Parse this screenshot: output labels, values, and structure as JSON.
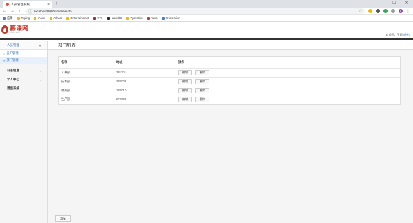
{
  "browser": {
    "tab_title": "人员管理系统",
    "tab_close": "×",
    "new_tab": "+",
    "window_controls": [
      "–",
      "❐",
      "✕"
    ],
    "url": "localhost:8080/sm/main.do",
    "nav_icons": [
      "←",
      "→",
      "↻",
      "ⓘ"
    ],
    "profile_initial": "L",
    "bookmarks": [
      {
        "label": "应用",
        "color": "#4a7bd1"
      },
      {
        "label": "Typing",
        "color": "#f4b400"
      },
      {
        "label": "Code",
        "color": "#f4b400"
      },
      {
        "label": "Others",
        "color": "#f4b400"
      },
      {
        "label": "Entertainment",
        "color": "#f4b400"
      },
      {
        "label": "SZU",
        "color": "#a3214a"
      },
      {
        "label": "lewell66",
        "color": "#24292e"
      },
      {
        "label": "ZyStation",
        "color": "#f4b400"
      },
      {
        "label": "Java",
        "color": "#c0392b"
      },
      {
        "label": "Translation",
        "color": "#4a7bd1"
      }
    ]
  },
  "header": {
    "logo_main": "慕课网",
    "logo_sub": "imooc.com",
    "welcome_prefix": "欢迎您，王雨",
    "logout": "[退出]"
  },
  "sidebar": {
    "groups": [
      {
        "label": "人员管理",
        "arrow": "▾",
        "active": true
      },
      {
        "label": "日志信息",
        "arrow": "›"
      },
      {
        "label": "个人中心",
        "arrow": "›"
      },
      {
        "label": "退出系统",
        "arrow": ""
      }
    ],
    "sub_items": [
      {
        "label": "员工管理",
        "arrow": "»"
      },
      {
        "label": "部门管理",
        "arrow": "»"
      }
    ]
  },
  "main": {
    "title": "部门列表",
    "columns": [
      "名称",
      "地址",
      "操作"
    ],
    "rows": [
      {
        "name": "人事部",
        "address": "3#1101"
      },
      {
        "name": "技术部",
        "address": "2#2002"
      },
      {
        "name": "财务部",
        "address": "1#2010"
      },
      {
        "name": "生产部",
        "address": "2#2008"
      }
    ],
    "edit_label": "编辑",
    "delete_label": "删除",
    "add_label": "添加"
  }
}
